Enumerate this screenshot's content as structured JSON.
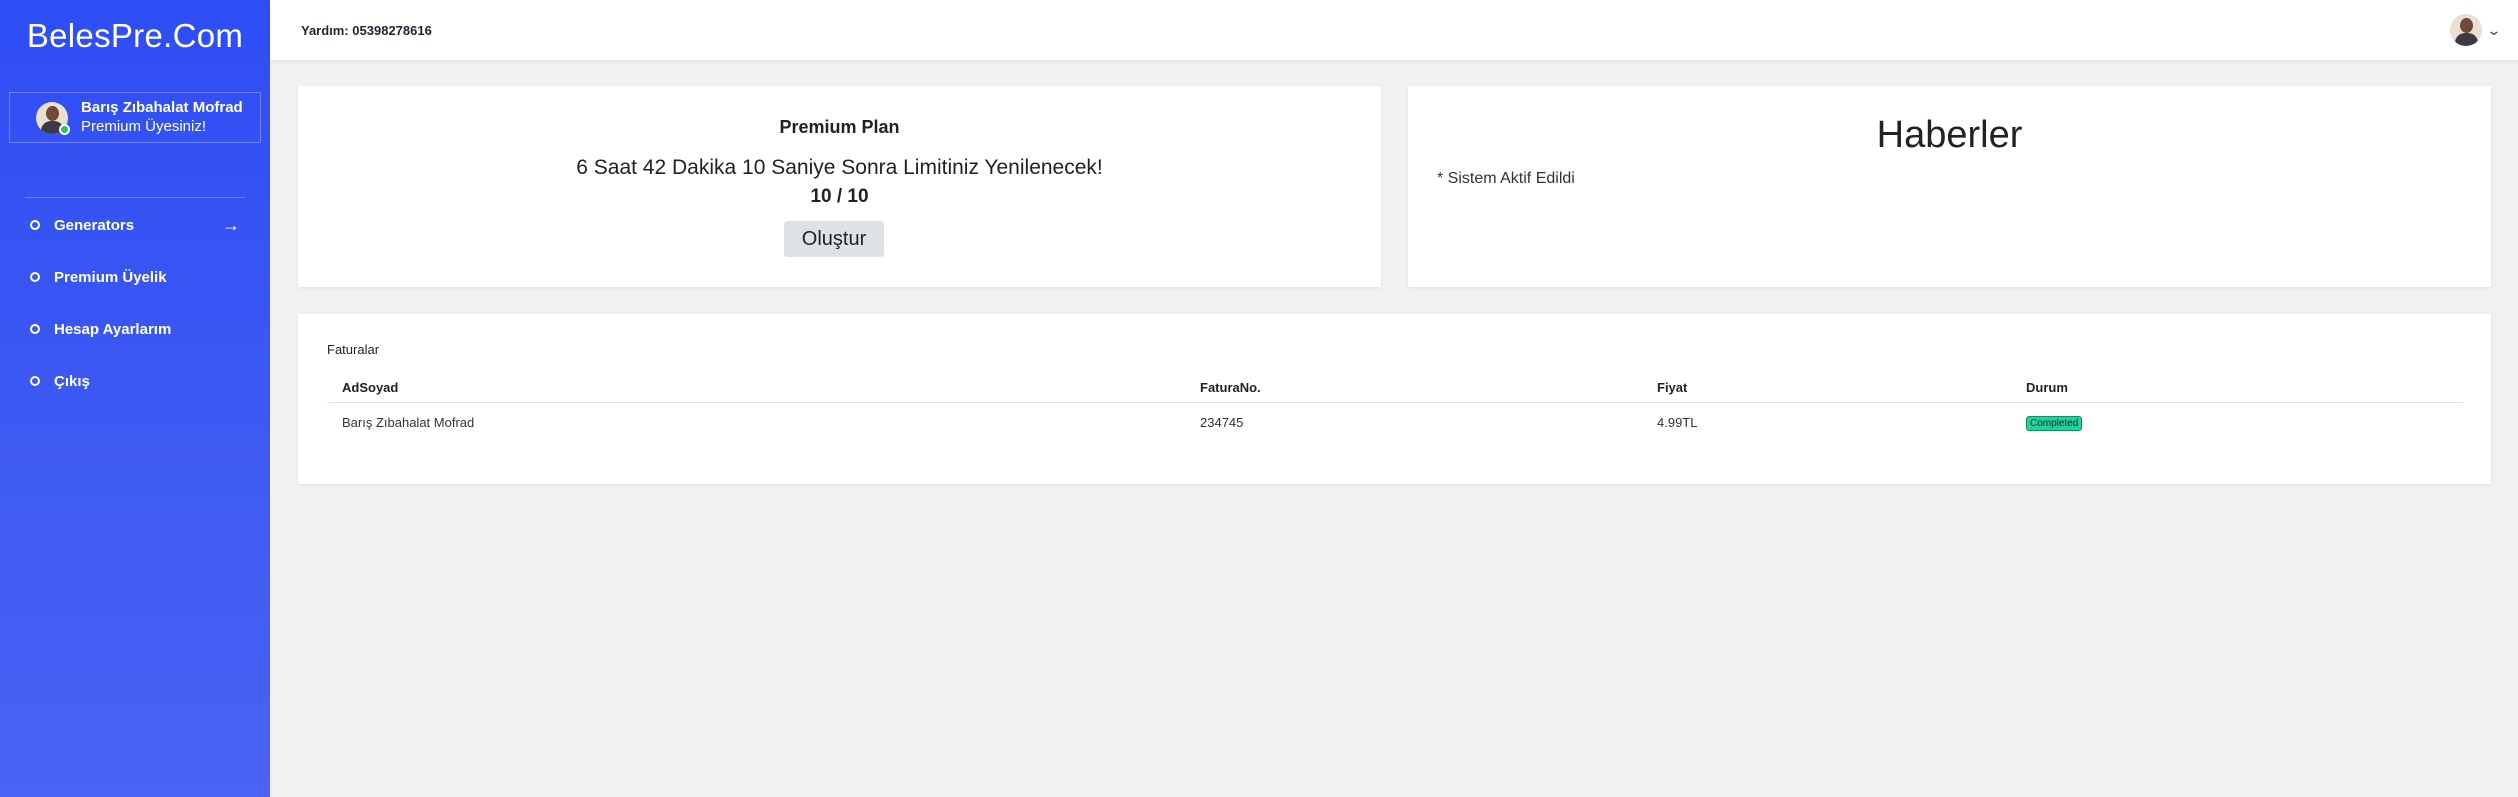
{
  "brand": "BelesPre.Com",
  "user": {
    "name": "Barış Zıbahalat Mofrad",
    "role": "Premium Üyesiniz!"
  },
  "nav": {
    "items": [
      {
        "label": "Generators",
        "arrow": "→"
      },
      {
        "label": "Premium Üyelik"
      },
      {
        "label": "Hesap Ayarlarım"
      },
      {
        "label": "Çıkış"
      }
    ]
  },
  "topbar": {
    "help": "Yardım: 05398278616"
  },
  "plan": {
    "title": "Premium Plan",
    "message": "6 Saat 42 Dakika 10 Saniye Sonra Limitiniz Yenilenecek!",
    "count": "10 / 10",
    "button": "Oluştur"
  },
  "news": {
    "title": "Haberler",
    "items": [
      "* Sistem Aktif Edildi"
    ]
  },
  "invoices": {
    "title": "Faturalar",
    "columns": [
      "AdSoyad",
      "FaturaNo.",
      "Fiyat",
      "Durum"
    ],
    "rows": [
      {
        "name": "Barış Zıbahalat Mofrad",
        "number": "234745",
        "price": "4.99TL",
        "status": "Completed"
      }
    ]
  },
  "colors": {
    "sidebar": "#2f4df5",
    "online": "#24c36a",
    "status_completed": "#1fd39a"
  }
}
